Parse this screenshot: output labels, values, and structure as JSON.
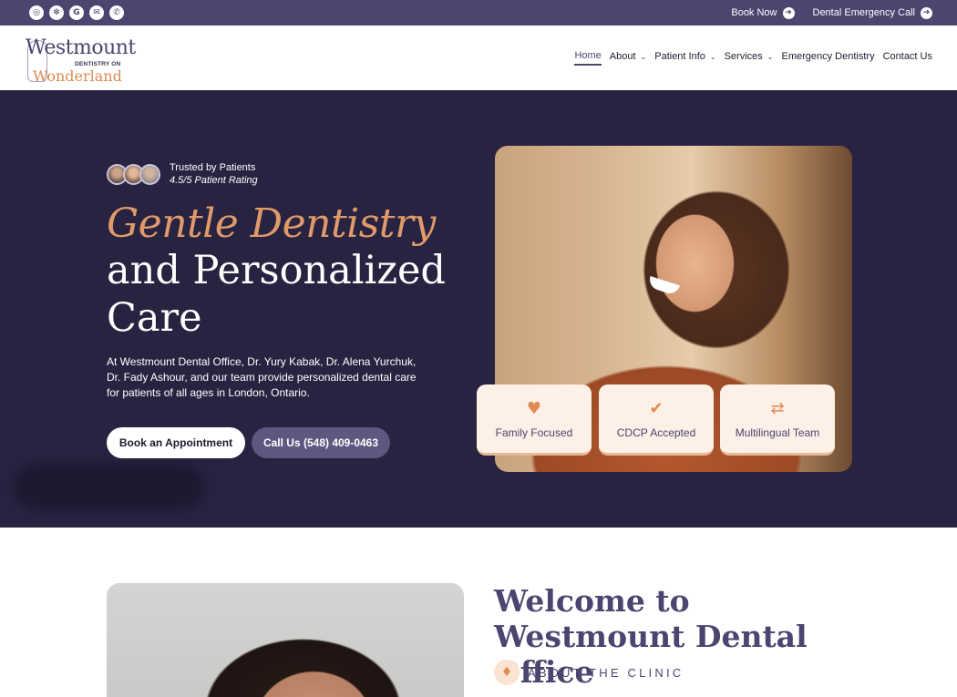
{
  "topbar": {
    "social_icons": [
      "instagram-icon",
      "yelp-icon",
      "google-icon",
      "email-icon",
      "phone-icon"
    ],
    "book_now": "Book Now",
    "emergency_call": "Dental Emergency Call"
  },
  "logo": {
    "line1": "Westmount",
    "line2": "DENTISTRY ON",
    "line3": "Wonderland"
  },
  "nav": {
    "home": "Home",
    "about": "About",
    "patient_info": "Patient Info",
    "services": "Services",
    "emergency": "Emergency Dentistry",
    "contact": "Contact Us"
  },
  "hero": {
    "trusted": "Trusted by Patients",
    "rating": "4.5/5 Patient Rating",
    "heading_accent": "Gentle Dentistry",
    "heading_main": "and Personalized Care",
    "description": "At Westmount Dental Office, Dr. Yury Kabak, Dr. Alena Yurchuk, Dr. Fady Ashour, and our team provide personalized dental care for patients of all ages in London, Ontario.",
    "book_button": "Book an Appointment",
    "call_button": "Call Us (548) 409-0463"
  },
  "features": [
    {
      "label": "Family Focused",
      "icon": "family-tooth-icon"
    },
    {
      "label": "CDCP Accepted",
      "icon": "tooth-check-icon"
    },
    {
      "label": "Multilingual Team",
      "icon": "translate-icon"
    }
  ],
  "welcome": {
    "title": "Welcome to Westmount Dental Office",
    "about_label": "ABOUT THE CLINIC"
  },
  "colors": {
    "topbar": "#4b4570",
    "hero_bg": "#282341",
    "accent": "#e09a6a",
    "primary": "#4b4570"
  }
}
